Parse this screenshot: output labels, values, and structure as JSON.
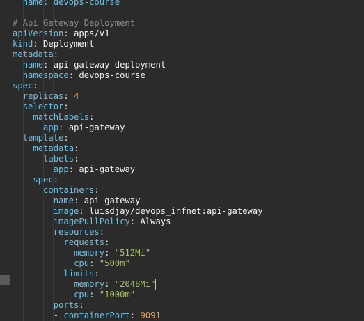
{
  "editor": {
    "colors": {
      "background": "#2b2b2b",
      "key": "#6ec1e4",
      "string": "#a5c261",
      "number": "#e89e5c",
      "comment": "#8a8a8a",
      "caret": "#f5c518"
    },
    "lines": [
      {
        "indent": "  ",
        "parts": [
          {
            "t": "name: devops-course",
            "c": "k"
          }
        ]
      },
      {
        "indent": "",
        "parts": [
          {
            "t": "---",
            "c": "p"
          }
        ]
      },
      {
        "indent": "",
        "parts": [
          {
            "t": "# Api Gateway Deployment",
            "c": "c"
          }
        ]
      },
      {
        "indent": "",
        "parts": [
          {
            "t": "apiVersion",
            "c": "k"
          },
          {
            "t": ": ",
            "c": "p"
          },
          {
            "t": "apps/v1",
            "c": "v"
          }
        ]
      },
      {
        "indent": "",
        "parts": [
          {
            "t": "kind",
            "c": "k"
          },
          {
            "t": ": ",
            "c": "p"
          },
          {
            "t": "Deployment",
            "c": "v"
          }
        ]
      },
      {
        "indent": "",
        "parts": [
          {
            "t": "metadata",
            "c": "k"
          },
          {
            "t": ":",
            "c": "p"
          }
        ]
      },
      {
        "indent": "  ",
        "parts": [
          {
            "t": "name",
            "c": "k"
          },
          {
            "t": ": ",
            "c": "p"
          },
          {
            "t": "api-gateway-deployment",
            "c": "v"
          }
        ]
      },
      {
        "indent": "  ",
        "parts": [
          {
            "t": "namespace",
            "c": "k"
          },
          {
            "t": ": ",
            "c": "p"
          },
          {
            "t": "devops-course",
            "c": "v"
          }
        ]
      },
      {
        "indent": "",
        "parts": [
          {
            "t": "spec",
            "c": "k"
          },
          {
            "t": ":",
            "c": "p"
          }
        ]
      },
      {
        "indent": "  ",
        "parts": [
          {
            "t": "replicas",
            "c": "k"
          },
          {
            "t": ": ",
            "c": "p"
          },
          {
            "t": "4",
            "c": "n"
          }
        ]
      },
      {
        "indent": "  ",
        "parts": [
          {
            "t": "selector",
            "c": "k"
          },
          {
            "t": ":",
            "c": "p"
          }
        ]
      },
      {
        "indent": "    ",
        "parts": [
          {
            "t": "matchLabels",
            "c": "k"
          },
          {
            "t": ":",
            "c": "p"
          }
        ]
      },
      {
        "indent": "      ",
        "parts": [
          {
            "t": "app",
            "c": "k"
          },
          {
            "t": ": ",
            "c": "p"
          },
          {
            "t": "api-gateway",
            "c": "v"
          }
        ]
      },
      {
        "indent": "  ",
        "parts": [
          {
            "t": "template",
            "c": "k"
          },
          {
            "t": ":",
            "c": "p"
          }
        ]
      },
      {
        "indent": "    ",
        "parts": [
          {
            "t": "metadata",
            "c": "k"
          },
          {
            "t": ":",
            "c": "p"
          }
        ]
      },
      {
        "indent": "      ",
        "parts": [
          {
            "t": "labels",
            "c": "k"
          },
          {
            "t": ":",
            "c": "p"
          }
        ]
      },
      {
        "indent": "        ",
        "parts": [
          {
            "t": "app",
            "c": "k"
          },
          {
            "t": ": ",
            "c": "p"
          },
          {
            "t": "api-gateway",
            "c": "v"
          }
        ]
      },
      {
        "indent": "    ",
        "parts": [
          {
            "t": "spec",
            "c": "k"
          },
          {
            "t": ":",
            "c": "p"
          }
        ]
      },
      {
        "indent": "      ",
        "parts": [
          {
            "t": "containers",
            "c": "k"
          },
          {
            "t": ":",
            "c": "p"
          }
        ]
      },
      {
        "indent": "      ",
        "parts": [
          {
            "t": "- ",
            "c": "p"
          },
          {
            "t": "name",
            "c": "k"
          },
          {
            "t": ": ",
            "c": "p"
          },
          {
            "t": "api-gateway",
            "c": "v"
          }
        ]
      },
      {
        "indent": "        ",
        "parts": [
          {
            "t": "image",
            "c": "k"
          },
          {
            "t": ": ",
            "c": "p"
          },
          {
            "t": "luisdjay/devops_infnet:api-gateway",
            "c": "v"
          }
        ]
      },
      {
        "indent": "        ",
        "parts": [
          {
            "t": "imagePullPolicy",
            "c": "k"
          },
          {
            "t": ": ",
            "c": "p"
          },
          {
            "t": "Always",
            "c": "v"
          }
        ]
      },
      {
        "indent": "        ",
        "parts": [
          {
            "t": "resources",
            "c": "k"
          },
          {
            "t": ":",
            "c": "p"
          }
        ]
      },
      {
        "indent": "          ",
        "parts": [
          {
            "t": "requests",
            "c": "k"
          },
          {
            "t": ":",
            "c": "p"
          }
        ]
      },
      {
        "indent": "            ",
        "parts": [
          {
            "t": "memory",
            "c": "k"
          },
          {
            "t": ": ",
            "c": "p"
          },
          {
            "t": "\"512Mi\"",
            "c": "s"
          }
        ]
      },
      {
        "indent": "            ",
        "parts": [
          {
            "t": "cpu",
            "c": "k"
          },
          {
            "t": ": ",
            "c": "p"
          },
          {
            "t": "\"500m\"",
            "c": "s"
          }
        ]
      },
      {
        "indent": "          ",
        "parts": [
          {
            "t": "limits",
            "c": "k"
          },
          {
            "t": ":",
            "c": "p"
          }
        ]
      },
      {
        "indent": "            ",
        "parts": [
          {
            "t": "memory",
            "c": "k"
          },
          {
            "t": ": ",
            "c": "p"
          },
          {
            "t": "\"2048Mi\"",
            "c": "s"
          }
        ],
        "caret": true
      },
      {
        "indent": "            ",
        "parts": [
          {
            "t": "cpu",
            "c": "k"
          },
          {
            "t": ": ",
            "c": "p"
          },
          {
            "t": "\"1000m\"",
            "c": "s"
          }
        ]
      },
      {
        "indent": "        ",
        "parts": [
          {
            "t": "ports",
            "c": "k"
          },
          {
            "t": ":",
            "c": "p"
          }
        ]
      },
      {
        "indent": "        ",
        "parts": [
          {
            "t": "- ",
            "c": "p"
          },
          {
            "t": "containerPort",
            "c": "k"
          },
          {
            "t": ": ",
            "c": "p"
          },
          {
            "t": "9091",
            "c": "n"
          }
        ]
      }
    ]
  }
}
